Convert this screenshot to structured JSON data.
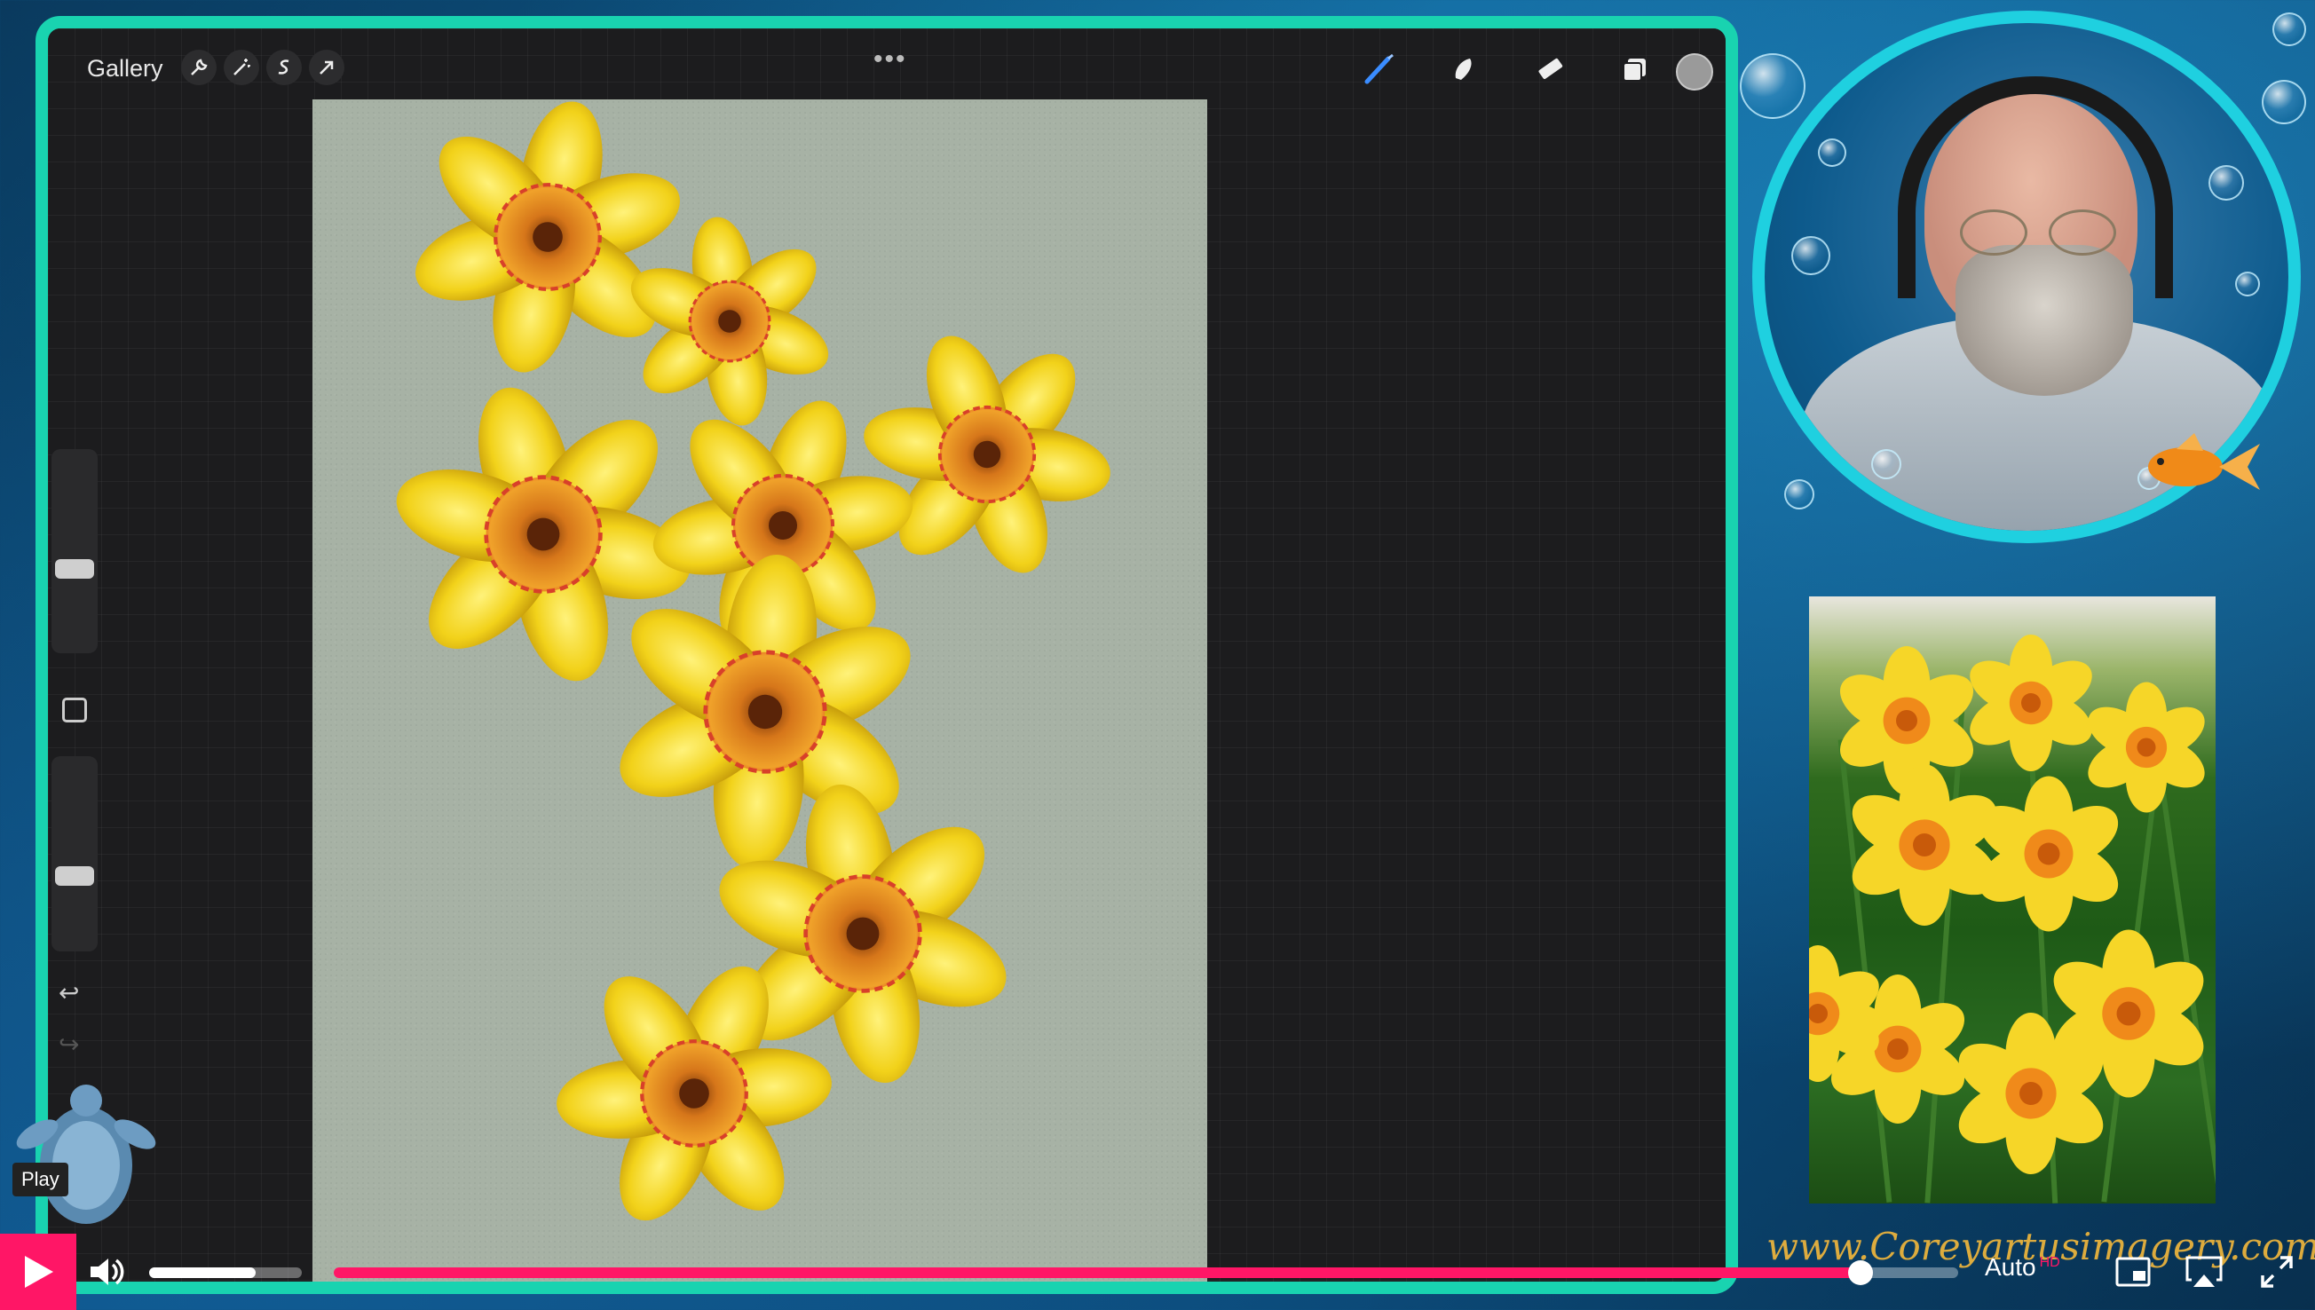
{
  "toolbar": {
    "gallery_label": "Gallery",
    "left_tools": [
      "wrench-icon",
      "magic-wand-icon",
      "selection-icon",
      "transform-arrow-icon"
    ],
    "right_tools": [
      "brush-icon",
      "smudge-icon",
      "eraser-icon",
      "layers-icon",
      "color-swatch"
    ],
    "current_color": "#9a9a9a"
  },
  "player": {
    "tooltip": "Play",
    "quality_label": "Auto",
    "quality_badge": "HD",
    "progress": 0.94,
    "volume": 0.7,
    "accent_color": "#ff1666"
  },
  "overlay": {
    "url_text": "www.Coreyartusimagery.com"
  },
  "colors": {
    "frame": "#19d3b0",
    "canvas": "#a7b2a5",
    "petal": "#f2d21a",
    "corona": "#e0761c"
  }
}
